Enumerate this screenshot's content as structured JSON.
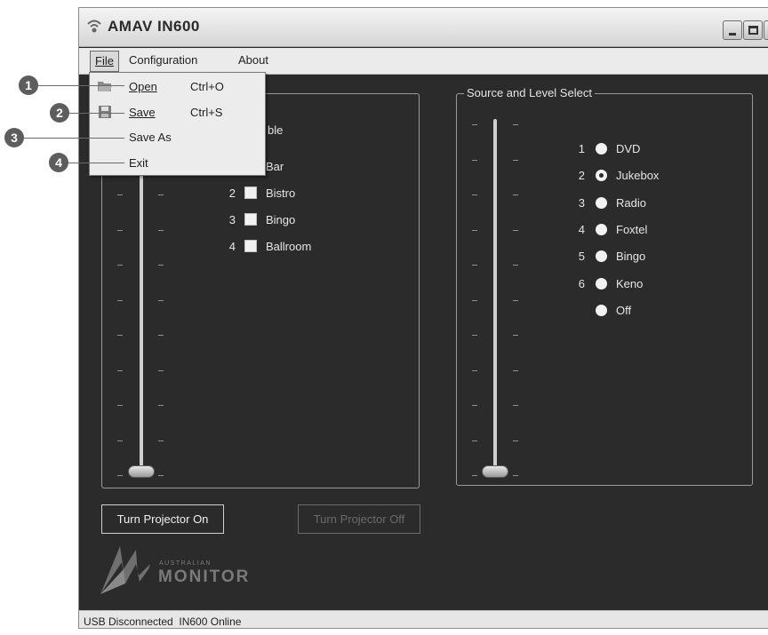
{
  "window": {
    "title": "AMAV IN600"
  },
  "menubar": {
    "file": "File",
    "configuration": "Configuration",
    "about": "About"
  },
  "file_menu": {
    "items": [
      {
        "label": "Open",
        "shortcut": "Ctrl+O",
        "icon": "folder-open-icon"
      },
      {
        "label": "Save",
        "shortcut": "Ctrl+S",
        "icon": "floppy-disk-icon"
      },
      {
        "label": "Save As",
        "shortcut": ""
      },
      {
        "label": "Exit",
        "shortcut": ""
      }
    ]
  },
  "callouts": [
    "1",
    "2",
    "3",
    "4"
  ],
  "zone_panel": {
    "enable_text": "ble",
    "zones": [
      {
        "num": "",
        "label": "Bar"
      },
      {
        "num": "2",
        "label": "Bistro"
      },
      {
        "num": "3",
        "label": "Bingo"
      },
      {
        "num": "4",
        "label": "Ballroom"
      }
    ]
  },
  "source_panel": {
    "title": "Source and Level Select",
    "sources": [
      {
        "num": "1",
        "label": "DVD",
        "selected": false
      },
      {
        "num": "2",
        "label": "Jukebox",
        "selected": true
      },
      {
        "num": "3",
        "label": "Radio",
        "selected": false
      },
      {
        "num": "4",
        "label": "Foxtel",
        "selected": false
      },
      {
        "num": "5",
        "label": "Bingo",
        "selected": false
      },
      {
        "num": "6",
        "label": "Keno",
        "selected": false
      },
      {
        "num": "",
        "label": "Off",
        "selected": false
      }
    ]
  },
  "sliders": {
    "left_level": 0,
    "right_level": 0
  },
  "buttons": {
    "projector_on": "Turn Projector On",
    "projector_off": "Turn Projector Off"
  },
  "logo": {
    "line1": "AUSTRALIAN",
    "line2": "MONITOR"
  },
  "statusbar": {
    "text": "USB Disconnected  IN600 Online"
  },
  "colors": {
    "panel_bg": "#2b2b2b",
    "menu_bg": "#ebebeb",
    "callout": "#5d5d5d"
  }
}
